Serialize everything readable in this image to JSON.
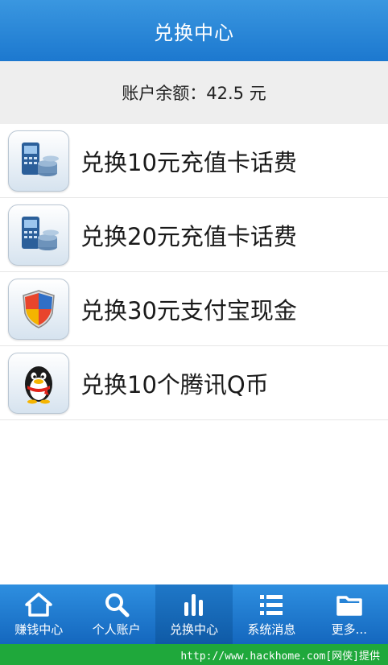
{
  "header": {
    "title": "兑换中心"
  },
  "balance": {
    "text": "账户余额：42.5 元"
  },
  "items": [
    {
      "label": "兑换10元充值卡话费",
      "icon": "phone-coins-icon"
    },
    {
      "label": "兑换20元充值卡话费",
      "icon": "phone-coins-icon"
    },
    {
      "label": "兑换30元支付宝现金",
      "icon": "shield-icon"
    },
    {
      "label": "兑换10个腾讯Q币",
      "icon": "penguin-icon"
    }
  ],
  "tabs": [
    {
      "label": "赚钱中心",
      "icon": "home-icon"
    },
    {
      "label": "个人账户",
      "icon": "search-icon"
    },
    {
      "label": "兑换中心",
      "icon": "bar-chart-icon",
      "active": true
    },
    {
      "label": "系统消息",
      "icon": "list-icon"
    },
    {
      "label": "更多...",
      "icon": "folder-icon"
    }
  ],
  "footer": {
    "text": "http://www.hackhome.com[网侠]提供"
  },
  "colors": {
    "primary": "#1c78cf",
    "footer": "#1fa83b",
    "balance_bg": "#eeeeee"
  }
}
